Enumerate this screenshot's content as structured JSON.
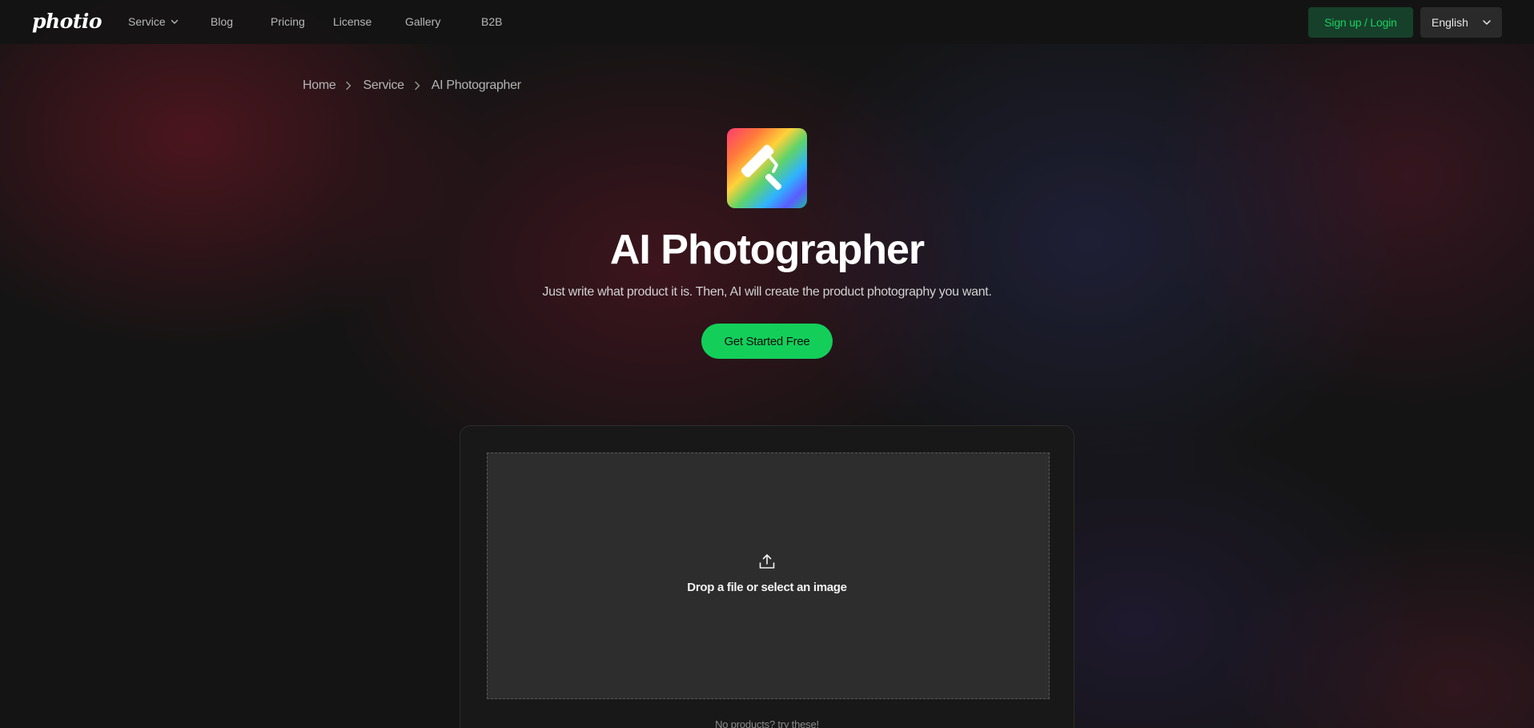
{
  "header": {
    "logo": "photio",
    "nav": [
      {
        "label": "Service"
      },
      {
        "label": "Blog"
      },
      {
        "label": "Pricing"
      },
      {
        "label": "License"
      },
      {
        "label": "Gallery"
      },
      {
        "label": "B2B"
      }
    ],
    "login_label": "Sign up / Login",
    "language": "English"
  },
  "breadcrumb": {
    "home": "Home",
    "service": "Service",
    "current": "AI Photographer"
  },
  "hero": {
    "title": "AI Photographer",
    "subtitle": "Just write what product it is. Then, AI will create the product photography you want.",
    "cta_label": "Get Started Free"
  },
  "upload": {
    "drop_text": "Drop a file or select an image",
    "hint": "No products? try these!"
  },
  "colors": {
    "accent": "#13cf5a",
    "login_bg": "#16402a",
    "background": "#141414"
  }
}
